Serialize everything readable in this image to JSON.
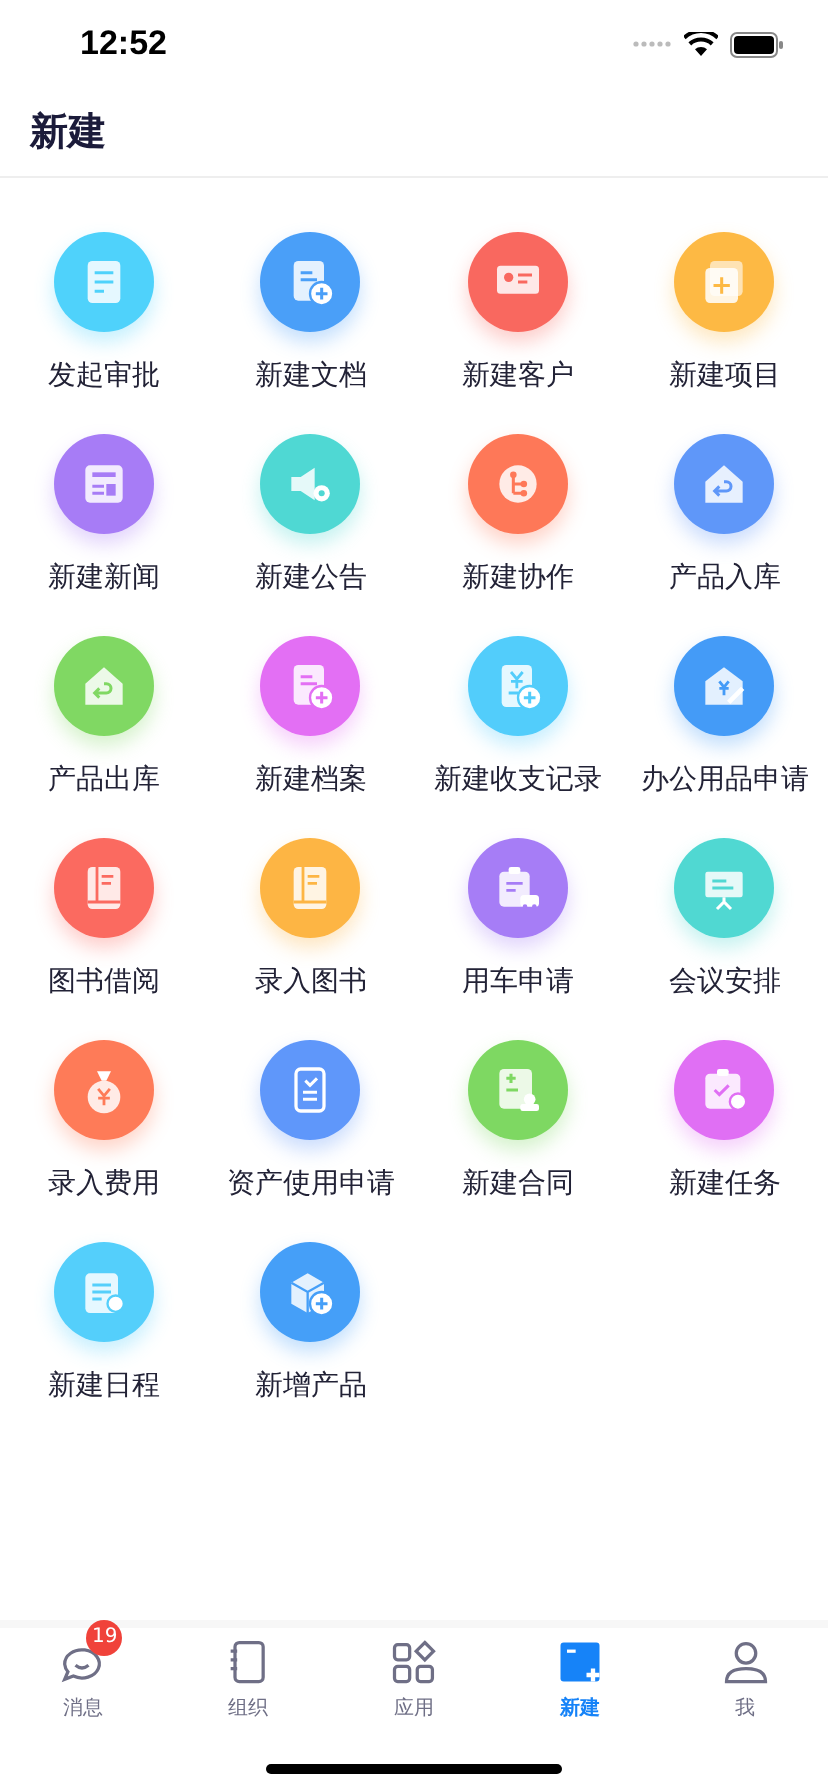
{
  "status_bar": {
    "time": "12:52"
  },
  "header": {
    "title": "新建"
  },
  "items": [
    {
      "label": "发起审批",
      "kind": "flow",
      "color": "#4fd2fb"
    },
    {
      "label": "新建文档",
      "kind": "docplus",
      "color": "#4a9ff8"
    },
    {
      "label": "新建客户",
      "kind": "card",
      "color": "#f9685f"
    },
    {
      "label": "新建项目",
      "kind": "folder",
      "color": "#fdb944"
    },
    {
      "label": "新建新闻",
      "kind": "news",
      "color": "#a77cf6"
    },
    {
      "label": "新建公告",
      "kind": "speaker",
      "color": "#4fd8d3"
    },
    {
      "label": "新建协作",
      "kind": "branch",
      "color": "#fe7858"
    },
    {
      "label": "产品入库",
      "kind": "house",
      "color": "#5f97f9"
    },
    {
      "label": "产品出库",
      "kind": "house",
      "color": "#80d863"
    },
    {
      "label": "新建档案",
      "kind": "docplus",
      "color": "#e36ff4"
    },
    {
      "label": "新建收支记录",
      "kind": "receipt",
      "color": "#52cdfb"
    },
    {
      "label": "办公用品申请",
      "kind": "wallet",
      "color": "#449bf7"
    },
    {
      "label": "图书借阅",
      "kind": "book",
      "color": "#fb6a60"
    },
    {
      "label": "录入图书",
      "kind": "book",
      "color": "#fdb544"
    },
    {
      "label": "用车申请",
      "kind": "car",
      "color": "#a67df6"
    },
    {
      "label": "会议安排",
      "kind": "board",
      "color": "#50d8d2"
    },
    {
      "label": "录入费用",
      "kind": "bag",
      "color": "#fe7b58"
    },
    {
      "label": "资产使用申请",
      "kind": "check",
      "color": "#5f97fa"
    },
    {
      "label": "新建合同",
      "kind": "stamp",
      "color": "#7ed862"
    },
    {
      "label": "新建任务",
      "kind": "task",
      "color": "#e06ff4"
    },
    {
      "label": "新建日程",
      "kind": "schedule",
      "color": "#54cffb"
    },
    {
      "label": "新增产品",
      "kind": "box",
      "color": "#459ff8"
    }
  ],
  "tabs": [
    {
      "label": "消息",
      "kind": "chat",
      "selected": false,
      "badge": "19"
    },
    {
      "label": "组织",
      "kind": "notebook",
      "selected": false
    },
    {
      "label": "应用",
      "kind": "apps",
      "selected": false
    },
    {
      "label": "新建",
      "kind": "new",
      "selected": true
    },
    {
      "label": "我",
      "kind": "person",
      "selected": false
    }
  ]
}
